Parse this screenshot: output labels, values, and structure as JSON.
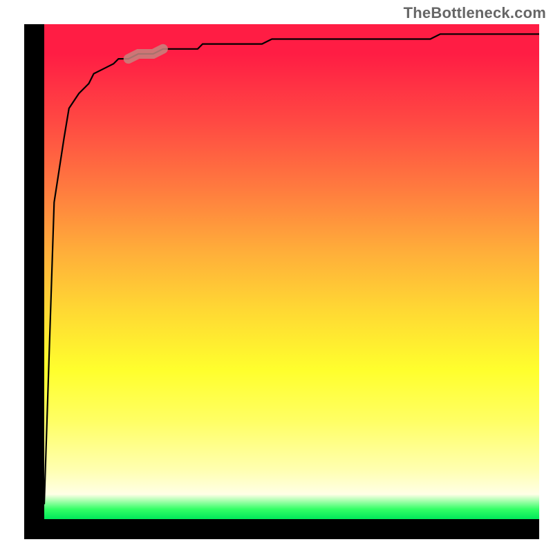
{
  "watermark": {
    "text": "TheBottleneck.com"
  },
  "chart_data": {
    "type": "line",
    "title": "",
    "xlabel": "",
    "ylabel": "",
    "x": [
      0.0,
      0.02,
      0.04,
      0.05,
      0.07,
      0.09,
      0.1,
      0.12,
      0.14,
      0.15,
      0.17,
      0.19,
      0.21,
      0.22,
      0.24,
      0.26,
      0.27,
      0.29,
      0.31,
      0.32,
      0.34,
      0.36,
      0.37,
      0.39,
      0.41,
      0.43,
      0.44,
      0.46,
      0.48,
      0.49,
      0.51,
      0.53,
      0.54,
      0.56,
      0.58,
      0.59,
      0.61,
      0.63,
      0.65,
      0.66,
      0.68,
      0.7,
      0.71,
      0.73,
      0.75,
      0.76,
      0.78,
      0.8,
      0.81,
      0.83,
      0.85,
      0.87,
      0.88,
      0.9,
      0.92,
      0.93,
      0.95,
      0.97,
      0.98,
      1.0
    ],
    "y": [
      0.03,
      0.64,
      0.77,
      0.83,
      0.86,
      0.88,
      0.9,
      0.91,
      0.92,
      0.93,
      0.93,
      0.94,
      0.94,
      0.94,
      0.95,
      0.95,
      0.95,
      0.95,
      0.95,
      0.96,
      0.96,
      0.96,
      0.96,
      0.96,
      0.96,
      0.96,
      0.96,
      0.97,
      0.97,
      0.97,
      0.97,
      0.97,
      0.97,
      0.97,
      0.97,
      0.97,
      0.97,
      0.97,
      0.97,
      0.97,
      0.97,
      0.97,
      0.97,
      0.97,
      0.97,
      0.97,
      0.97,
      0.98,
      0.98,
      0.98,
      0.98,
      0.98,
      0.98,
      0.98,
      0.98,
      0.98,
      0.98,
      0.98,
      0.98,
      0.98
    ],
    "xlim": [
      0,
      1
    ],
    "ylim": [
      0,
      1
    ],
    "highlight_segment": {
      "x_start": 0.17,
      "x_end": 0.25
    },
    "gradient_colormap": "green_to_red_vertical",
    "legend": [],
    "grid": false
  },
  "colors": {
    "frame": "#000000",
    "curve": "#000000",
    "highlight": "#c6857f"
  }
}
